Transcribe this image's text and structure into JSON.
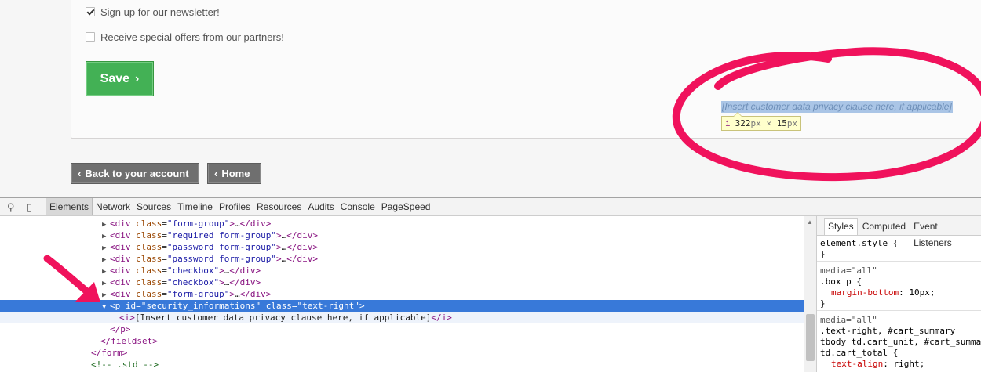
{
  "form": {
    "newsletter": {
      "label": "Sign up for our newsletter!",
      "checked": true
    },
    "partner_offers": {
      "label": "Receive special offers from our partners!",
      "checked": false
    },
    "save_label": "Save",
    "privacy_text": "[Insert customer data privacy clause here, if applicable]",
    "inspector_tooltip": {
      "tag": "i",
      "width": "322",
      "height": "15",
      "unit": "px",
      "times": "×"
    }
  },
  "nav": {
    "back_label": "Back to your account",
    "home_label": "Home",
    "chevron_left": "‹",
    "chevron_right": "›"
  },
  "devtools": {
    "tabs": [
      "Elements",
      "Network",
      "Sources",
      "Timeline",
      "Profiles",
      "Resources",
      "Audits",
      "Console",
      "PageSpeed"
    ],
    "active_tab": "Elements",
    "tree": [
      {
        "indent": 0,
        "arrow": "▶",
        "tag": "div",
        "attrs": [
          [
            "class",
            "form-group"
          ]
        ],
        "collapsed": true
      },
      {
        "indent": 0,
        "arrow": "▶",
        "tag": "div",
        "attrs": [
          [
            "class",
            "required form-group"
          ]
        ],
        "collapsed": true
      },
      {
        "indent": 0,
        "arrow": "▶",
        "tag": "div",
        "attrs": [
          [
            "class",
            "password form-group"
          ]
        ],
        "collapsed": true
      },
      {
        "indent": 0,
        "arrow": "▶",
        "tag": "div",
        "attrs": [
          [
            "class",
            "password form-group"
          ]
        ],
        "collapsed": true
      },
      {
        "indent": 0,
        "arrow": "▶",
        "tag": "div",
        "attrs": [
          [
            "class",
            "checkbox"
          ]
        ],
        "collapsed": true
      },
      {
        "indent": 0,
        "arrow": "▶",
        "tag": "div",
        "attrs": [
          [
            "class",
            "checkbox"
          ]
        ],
        "collapsed": true
      },
      {
        "indent": 0,
        "arrow": "▶",
        "tag": "div",
        "attrs": [
          [
            "class",
            "form-group"
          ]
        ],
        "collapsed": true
      },
      {
        "indent": 0,
        "arrow": "▼",
        "tag": "p",
        "attrs": [
          [
            "id",
            "security_informations"
          ],
          [
            "class",
            "text-right"
          ]
        ],
        "selected": true
      },
      {
        "indent": 1,
        "raw": "<i>[Insert customer data privacy clause here, if applicable]</i>"
      },
      {
        "indent": 0,
        "raw": "</p>"
      },
      {
        "indent": -1,
        "raw": "</fieldset>"
      },
      {
        "indent": -2,
        "raw": "</form>"
      },
      {
        "indent": -2,
        "comment": "<!-- .std -->"
      }
    ],
    "styles": {
      "tabs": [
        "Styles",
        "Computed",
        "Event Listeners"
      ],
      "active_tab": "Styles",
      "rules": [
        {
          "lines": [
            "element.style {",
            "}"
          ]
        },
        {
          "media": "media=\"all\"",
          "lines": [
            ".box p {",
            "  margin-bottom: 10px;",
            "}"
          ]
        },
        {
          "media": "media=\"all\"",
          "lines": [
            ".text-right, #cart_summary",
            "tbody td.cart_unit, #cart_summary",
            "td.cart_total {",
            "  text-align: right;"
          ]
        }
      ]
    }
  },
  "colors": {
    "save_green": "#43b155",
    "nav_gray": "#6f6f6f",
    "selection_blue": "#3879d9",
    "annotation_pink": "#f0125c"
  }
}
